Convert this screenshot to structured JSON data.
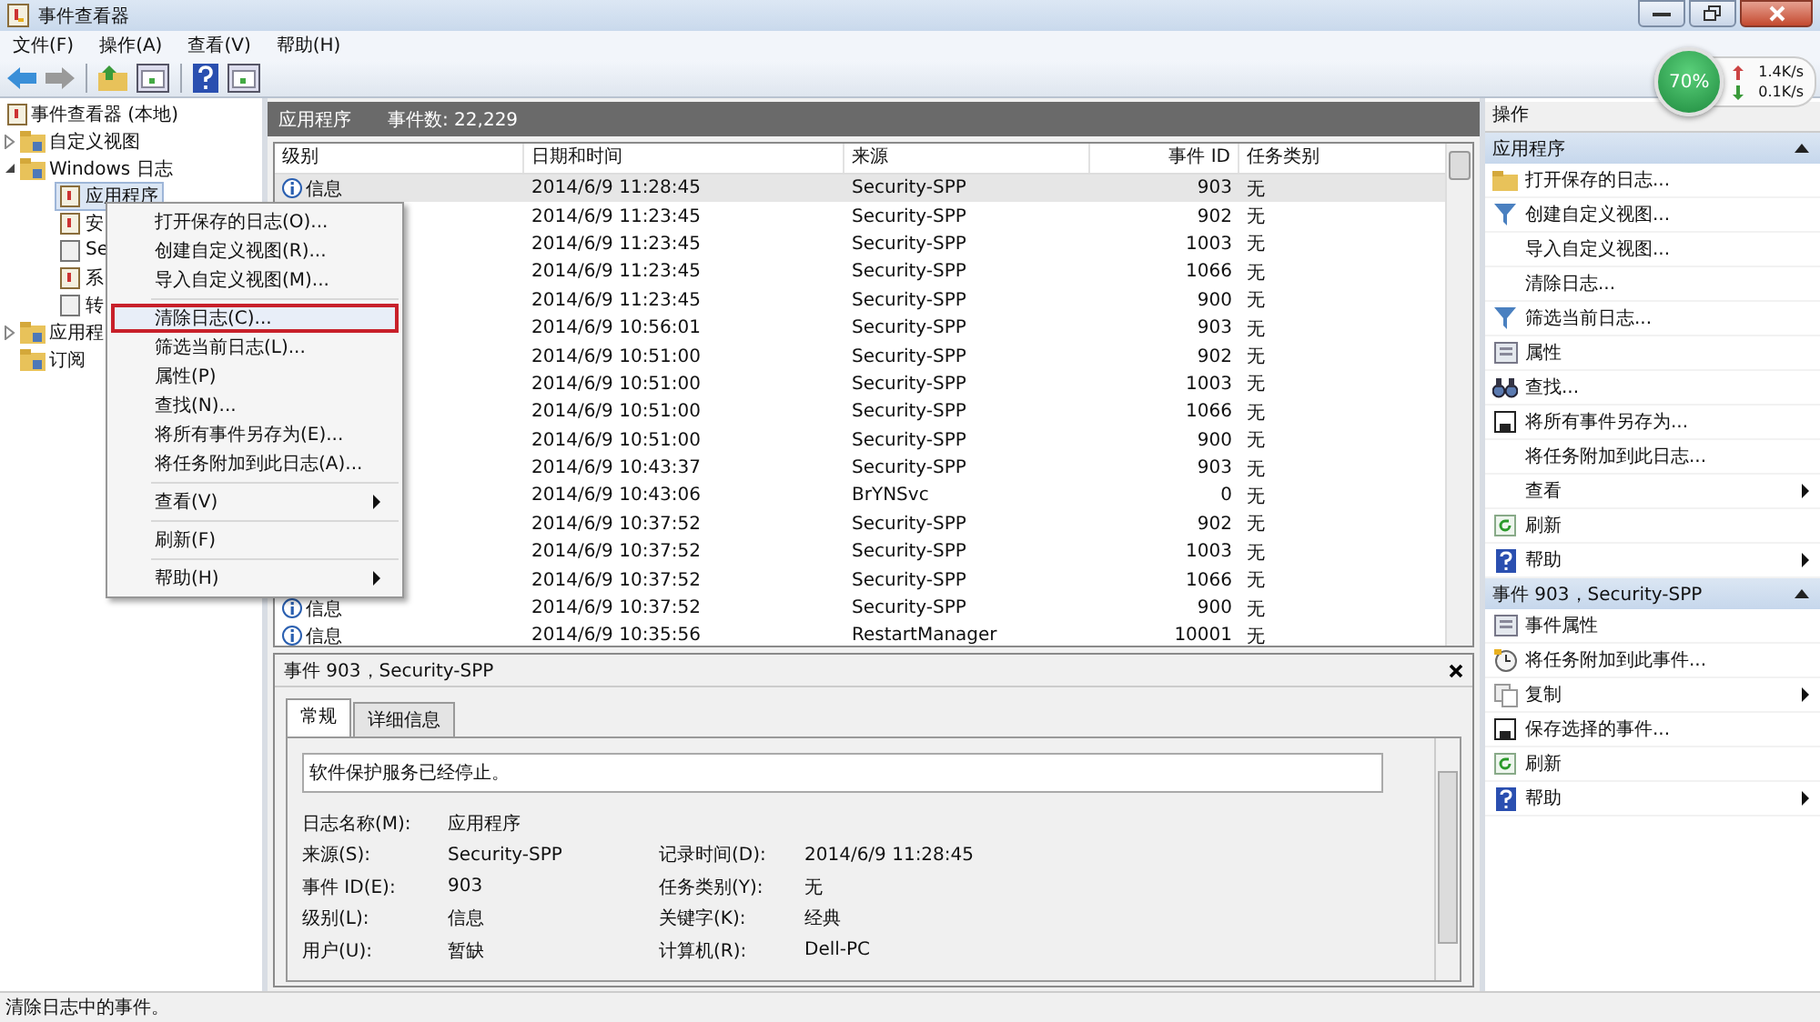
{
  "window": {
    "title": "事件查看器"
  },
  "menubar": [
    "文件(F)",
    "操作(A)",
    "查看(V)",
    "帮助(H)"
  ],
  "tree": {
    "label": "事件查看器 (本地)",
    "children": [
      {
        "label": "自定义视图",
        "expanded": false,
        "kind": "folder"
      },
      {
        "label": "Windows 日志",
        "expanded": true,
        "kind": "folder",
        "children": [
          {
            "label": "应用程序",
            "selected": true,
            "kind": "log"
          },
          {
            "label": "安",
            "selected": false,
            "kind": "log"
          },
          {
            "label": "Se",
            "selected": false,
            "kind": "blank"
          },
          {
            "label": "系",
            "selected": false,
            "kind": "log"
          },
          {
            "label": "转",
            "selected": false,
            "kind": "blank"
          }
        ]
      },
      {
        "label": "应用程",
        "expanded": false,
        "kind": "folder"
      },
      {
        "label": "订阅",
        "kind": "folder"
      }
    ]
  },
  "list_header": {
    "title": "应用程序",
    "count": "事件数: 22,229"
  },
  "table": {
    "columns": [
      "级别",
      "日期和时间",
      "来源",
      "事件 ID",
      "任务类别"
    ],
    "rows": [
      {
        "level": "信息",
        "date": "2014/6/9 11:28:45",
        "source": "Security-SPP",
        "id": "903",
        "task": "无",
        "selected": true
      },
      {
        "date": "2014/6/9 11:23:45",
        "source": "Security-SPP",
        "id": "902",
        "task": "无",
        "selected": false
      },
      {
        "date": "2014/6/9 11:23:45",
        "source": "Security-SPP",
        "id": "1003",
        "task": "无",
        "selected": false
      },
      {
        "date": "2014/6/9 11:23:45",
        "source": "Security-SPP",
        "id": "1066",
        "task": "无",
        "selected": false
      },
      {
        "date": "2014/6/9 11:23:45",
        "source": "Security-SPP",
        "id": "900",
        "task": "无",
        "selected": false
      },
      {
        "date": "2014/6/9 10:56:01",
        "source": "Security-SPP",
        "id": "903",
        "task": "无",
        "selected": false
      },
      {
        "date": "2014/6/9 10:51:00",
        "source": "Security-SPP",
        "id": "902",
        "task": "无",
        "selected": false
      },
      {
        "date": "2014/6/9 10:51:00",
        "source": "Security-SPP",
        "id": "1003",
        "task": "无",
        "selected": false
      },
      {
        "date": "2014/6/9 10:51:00",
        "source": "Security-SPP",
        "id": "1066",
        "task": "无",
        "selected": false
      },
      {
        "date": "2014/6/9 10:51:00",
        "source": "Security-SPP",
        "id": "900",
        "task": "无",
        "selected": false
      },
      {
        "date": "2014/6/9 10:43:37",
        "source": "Security-SPP",
        "id": "903",
        "task": "无",
        "selected": false
      },
      {
        "date": "2014/6/9 10:43:06",
        "source": "BrYNSvc",
        "id": "0",
        "task": "无",
        "selected": false
      },
      {
        "date": "2014/6/9 10:37:52",
        "source": "Security-SPP",
        "id": "902",
        "task": "无",
        "selected": false
      },
      {
        "date": "2014/6/9 10:37:52",
        "source": "Security-SPP",
        "id": "1003",
        "task": "无",
        "selected": false
      },
      {
        "date": "2014/6/9 10:37:52",
        "source": "Security-SPP",
        "id": "1066",
        "task": "无",
        "selected": false
      },
      {
        "level": "信息",
        "date": "2014/6/9 10:37:52",
        "source": "Security-SPP",
        "id": "900",
        "task": "无",
        "selected": false
      },
      {
        "level": "信息",
        "date": "2014/6/9 10:35:56",
        "source": "RestartManager",
        "id": "10001",
        "task": "无",
        "selected": false
      }
    ]
  },
  "detail": {
    "title": "事件 903，Security-SPP",
    "tabs": [
      {
        "label": "常规",
        "selected": true
      },
      {
        "label": "详细信息",
        "selected": false
      }
    ],
    "message": "软件保护服务已经停止。",
    "fields": [
      {
        "label": "日志名称(M):",
        "value": "应用程序"
      },
      {
        "label": "来源(S):",
        "value": "Security-SPP",
        "label2": "记录时间(D):",
        "value2": "2014/6/9 11:28:45"
      },
      {
        "label": "事件 ID(E):",
        "value": "903",
        "label2": "任务类别(Y):",
        "value2": "无"
      },
      {
        "label": "级别(L):",
        "value": "信息",
        "label2": "关键字(K):",
        "value2": "经典"
      },
      {
        "label": "用户(U):",
        "value": "暂缺",
        "label2": "计算机(R):",
        "value2": "Dell-PC"
      }
    ]
  },
  "context_menu": [
    {
      "kind": "item",
      "label": "打开保存的日志(O)...",
      "highlighted": false
    },
    {
      "kind": "item",
      "label": "创建自定义视图(R)...",
      "highlighted": false
    },
    {
      "kind": "item",
      "label": "导入自定义视图(M)...",
      "highlighted": false
    },
    {
      "kind": "separator"
    },
    {
      "kind": "item",
      "label": "清除日志(C)...",
      "highlighted": true
    },
    {
      "kind": "item",
      "label": "筛选当前日志(L)...",
      "highlighted": false
    },
    {
      "kind": "item",
      "label": "属性(P)",
      "highlighted": false
    },
    {
      "kind": "item",
      "label": "查找(N)...",
      "highlighted": false
    },
    {
      "kind": "item",
      "label": "将所有事件另存为(E)...",
      "highlighted": false
    },
    {
      "kind": "item",
      "label": "将任务附加到此日志(A)...",
      "highlighted": false
    },
    {
      "kind": "separator"
    },
    {
      "kind": "submenu",
      "label": "查看(V)",
      "highlighted": false
    },
    {
      "kind": "separator"
    },
    {
      "kind": "item",
      "label": "刷新(F)",
      "highlighted": false
    },
    {
      "kind": "separator"
    },
    {
      "kind": "submenu",
      "label": "帮助(H)",
      "highlighted": false
    }
  ],
  "actions": {
    "title": "操作",
    "sections": [
      {
        "title": "应用程序",
        "items": [
          {
            "kind": "folder",
            "label": "打开保存的日志..."
          },
          {
            "kind": "filter",
            "label": "创建自定义视图..."
          },
          {
            "kind": "none",
            "label": "导入自定义视图..."
          },
          {
            "kind": "none",
            "label": "清除日志..."
          },
          {
            "kind": "filter",
            "label": "筛选当前日志..."
          },
          {
            "kind": "properties",
            "label": "属性"
          },
          {
            "kind": "find",
            "label": "查找..."
          },
          {
            "kind": "save",
            "label": "将所有事件另存为..."
          },
          {
            "kind": "none",
            "label": "将任务附加到此日志..."
          },
          {
            "kind": "none",
            "label": "查看",
            "submenu": true
          },
          {
            "kind": "refresh",
            "label": "刷新"
          },
          {
            "kind": "help",
            "label": "帮助",
            "submenu": true
          }
        ]
      },
      {
        "title": "事件 903，Security-SPP",
        "items": [
          {
            "kind": "properties",
            "label": "事件属性"
          },
          {
            "kind": "task",
            "label": "将任务附加到此事件..."
          },
          {
            "kind": "copy",
            "label": "复制",
            "submenu": true
          },
          {
            "kind": "save",
            "label": "保存选择的事件..."
          },
          {
            "kind": "refresh",
            "label": "刷新"
          },
          {
            "kind": "help",
            "label": "帮助",
            "submenu": true
          }
        ]
      }
    ]
  },
  "net_widget": {
    "percent": "70%",
    "up": "1.4K/s",
    "down": "0.1K/s"
  },
  "status_bar": "清除日志中的事件。"
}
